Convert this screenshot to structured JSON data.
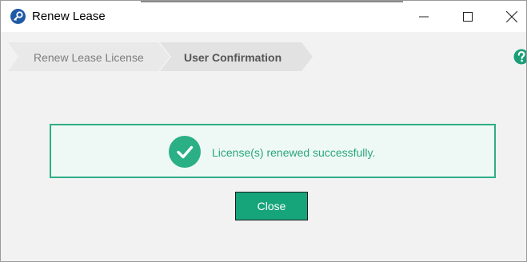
{
  "window": {
    "title": "Renew Lease"
  },
  "breadcrumb": {
    "steps": [
      {
        "label": "Renew Lease License",
        "active": false
      },
      {
        "label": "User Confirmation",
        "active": true
      }
    ]
  },
  "message": {
    "text": "License(s) renewed successfully."
  },
  "actions": {
    "close_label": "Close"
  },
  "icons": {
    "app": "key-icon",
    "help": "help-icon",
    "success": "check-circle-icon"
  },
  "colors": {
    "success": "#2eae86",
    "success_bg": "#eef9f5",
    "button": "#16a47a",
    "help": "#1a9e76",
    "app_icon": "#1f5aa6"
  }
}
